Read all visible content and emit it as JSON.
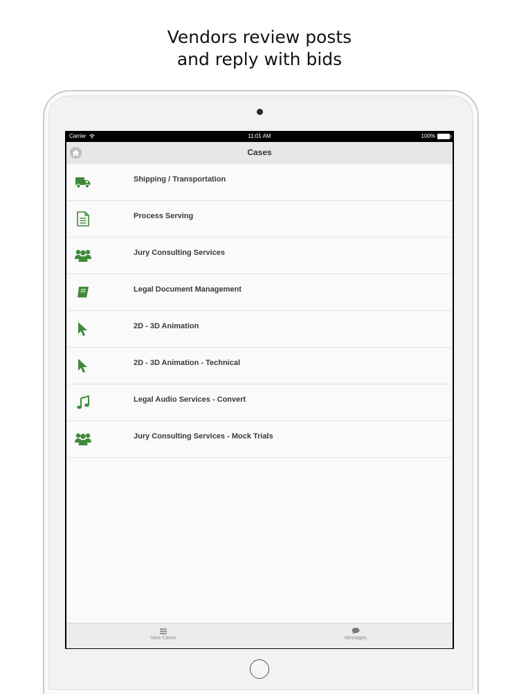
{
  "headline": {
    "line1": "Vendors review posts",
    "line2": "and reply with bids"
  },
  "status_bar": {
    "carrier": "Carrier",
    "time": "11:01 AM",
    "battery": "100%"
  },
  "nav": {
    "title": "Cases",
    "home_icon": "home-icon"
  },
  "accent_color": "#3f8a3b",
  "cases": [
    {
      "label": "Shipping / Transportation",
      "icon": "truck-icon"
    },
    {
      "label": "Process Serving",
      "icon": "document-icon"
    },
    {
      "label": "Jury Consulting Services",
      "icon": "users-icon"
    },
    {
      "label": "Legal Document Management",
      "icon": "book-icon"
    },
    {
      "label": "2D - 3D Animation",
      "icon": "cursor-icon"
    },
    {
      "label": "2D - 3D Animation - Technical",
      "icon": "cursor-icon"
    },
    {
      "label": "Legal Audio Services - Convert",
      "icon": "music-icon"
    },
    {
      "label": "Jury Consulting Services - Mock Trials",
      "icon": "users-icon"
    }
  ],
  "tabbar": {
    "tabs": [
      {
        "label": "View Cases",
        "icon": "list-icon"
      },
      {
        "label": "Messages",
        "icon": "chat-bubble-icon"
      }
    ]
  }
}
